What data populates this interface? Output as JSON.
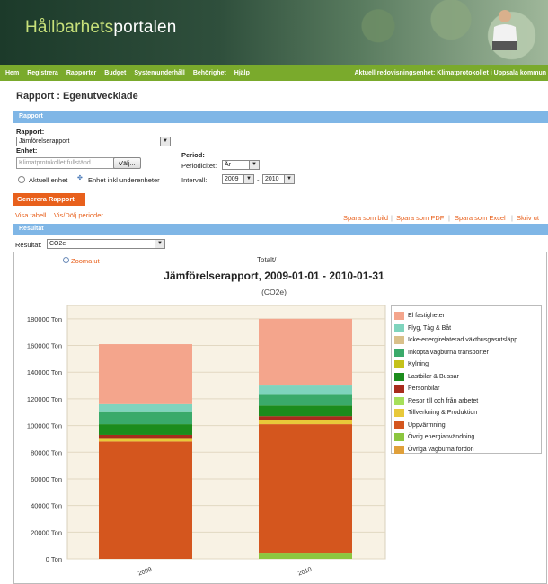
{
  "brand": {
    "prefix": "Hållbarhets",
    "suffix": "portalen"
  },
  "nav": {
    "items": [
      "Hem",
      "Registrera",
      "Rapporter",
      "Budget",
      "Systemunderhåll",
      "Behörighet",
      "Hjälp"
    ],
    "unit": "Aktuell redovisningsenhet: Klimatprotokollet i Uppsala kommun"
  },
  "page_title": "Rapport : Egenutvecklade",
  "report_section": {
    "header": "Rapport",
    "report_label": "Rapport:",
    "report_value": "Jämförelserapport",
    "unit_label": "Enhet:",
    "unit_placeholder": "Klimatprotokollet fullständ",
    "choose_button": "Välj...",
    "radio_current": "Aktuell enhet",
    "radio_sub": "Enhet inkl underenheter",
    "period_label": "Period:",
    "periodicity_label": "Periodicitet:",
    "periodicity_value": "År",
    "interval_label": "Intervall:",
    "interval_from": "2009",
    "interval_dash": "-",
    "interval_to": "2010",
    "generate_button": "Generera Rapport"
  },
  "links": {
    "show_table": "Visa tabell",
    "toggle_periods": "Vis/Dölj perioder",
    "save_image": "Spara som bild",
    "save_pdf": "Spara som PDF",
    "save_excel": "Spara som Excel",
    "print": "Skriv ut",
    "sep": "|"
  },
  "result_section": {
    "header": "Resultat",
    "result_label": "Resultat:",
    "result_value": "CO2e"
  },
  "chart_header": {
    "zoom_out": "Zooma ut",
    "totalt": "Totalt/"
  },
  "chart_data": {
    "type": "bar",
    "stacked": true,
    "title": "Jämförelserapport, 2009-01-01 - 2010-01-31",
    "subtitle": "(CO2e)",
    "categories": [
      "2009",
      "2010"
    ],
    "ylim": [
      0,
      190000
    ],
    "yticks": [
      0,
      20000,
      40000,
      60000,
      80000,
      100000,
      120000,
      140000,
      160000,
      180000
    ],
    "ytick_labels": [
      "0 Ton",
      "20000 Ton",
      "40000 Ton",
      "60000 Ton",
      "80000 Ton",
      "100000 Ton",
      "120000 Ton",
      "140000 Ton",
      "160000 Ton",
      "180000 Ton"
    ],
    "grid": true,
    "legend_position": "right",
    "series": [
      {
        "name": "Övrig energianvändning",
        "color": "#8cc63f",
        "values": [
          0,
          4000
        ]
      },
      {
        "name": "Uppvärmning",
        "color": "#d4561e",
        "values": [
          88000,
          97000
        ]
      },
      {
        "name": "Tillverkning & Produktion",
        "color": "#e8c93a",
        "values": [
          2000,
          3000
        ]
      },
      {
        "name": "Personbilar",
        "color": "#a82c1c",
        "values": [
          3000,
          3000
        ]
      },
      {
        "name": "Lastbilar & Bussar",
        "color": "#1c8c1c",
        "values": [
          8000,
          8000
        ]
      },
      {
        "name": "Inköpta vägburna transporter",
        "color": "#3aaa6a",
        "values": [
          9000,
          8000
        ]
      },
      {
        "name": "Flyg, Tåg & Båt",
        "color": "#7fd4bd",
        "values": [
          6000,
          7000
        ]
      },
      {
        "name": "El fastigheter",
        "color": "#f4a58c",
        "values": [
          45000,
          50000
        ]
      }
    ],
    "legend": [
      {
        "name": "El fastigheter",
        "color": "#f4a58c"
      },
      {
        "name": "Flyg, Tåg & Båt",
        "color": "#7fd4bd"
      },
      {
        "name": "Icke-energirelaterad växthusgasutsläpp",
        "color": "#d9c08a"
      },
      {
        "name": "Inköpta vägburna transporter",
        "color": "#3aaa6a"
      },
      {
        "name": "Kylning",
        "color": "#c4c21a"
      },
      {
        "name": "Lastbilar & Bussar",
        "color": "#1c8c1c"
      },
      {
        "name": "Personbilar",
        "color": "#a82c1c"
      },
      {
        "name": "Resor till och från arbetet",
        "color": "#a6e05a"
      },
      {
        "name": "Tillverkning & Produktion",
        "color": "#e8c93a"
      },
      {
        "name": "Uppvärmning",
        "color": "#d4561e"
      },
      {
        "name": "Övrig energianvändning",
        "color": "#8cc63f"
      },
      {
        "name": "Övriga vägburna fordon",
        "color": "#e0a03a"
      }
    ]
  }
}
